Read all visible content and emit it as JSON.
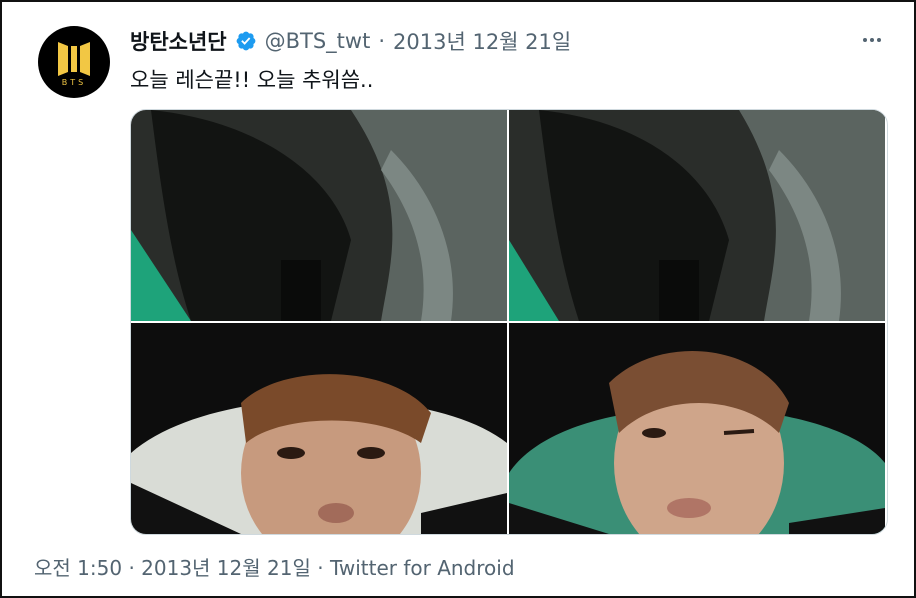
{
  "tweet": {
    "display_name": "방탄소년단",
    "handle": "@BTS_twt",
    "separator": "·",
    "date": "2013년 12월 21일",
    "text": "오늘 레슨끝!! 오늘 추워씀..",
    "more_icon": "more-horizontal-icon",
    "verified_icon": "verified-badge-icon"
  },
  "avatar": {
    "logo_text": "BTS"
  },
  "footer": {
    "time": "오전 1:50",
    "separator1": "·",
    "date": "2013년 12월 21일",
    "separator2": "·",
    "source": "Twitter for Android"
  },
  "colors": {
    "text_primary": "#0f1419",
    "text_secondary": "#536471",
    "verified": "#1d9bf0",
    "logo_gold": "#f2c744"
  }
}
